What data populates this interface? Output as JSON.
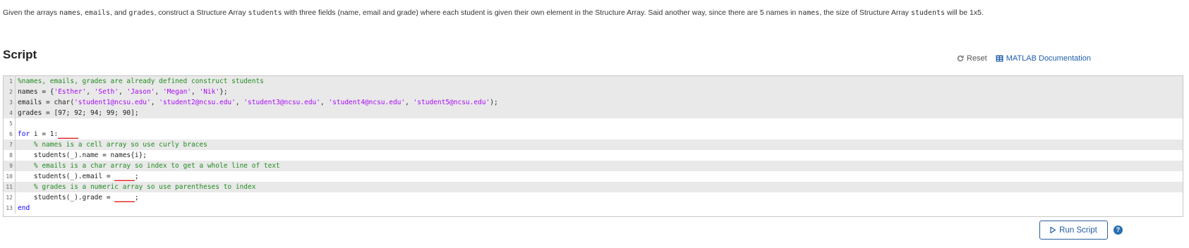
{
  "description": {
    "t1": "Given the arrays ",
    "c1": "names",
    "t2": ", ",
    "c2": "emails",
    "t3": ", and ",
    "c3": "grades",
    "t4": ", construct a Structure Array ",
    "c4": "students",
    "t5": " with three fields (name, email and grade) where each student is given their own element in the Structure Array. Said another way, since there are 5 names in ",
    "c5": "names",
    "t6": ", the size of Structure Array ",
    "c6": "students",
    "t7": " will be 1x5."
  },
  "section_title": "Script",
  "actions": {
    "reset_label": "Reset",
    "docs_label": "MATLAB Documentation"
  },
  "editor": {
    "line_numbers": [
      "1",
      "2",
      "3",
      "4",
      "5",
      "6",
      "7",
      "8",
      "9",
      "10",
      "11",
      "12",
      "13"
    ],
    "l1": "%names, emails, grades are already defined construct students",
    "l2a": "names = {",
    "l2s1": "'Esther'",
    "l2s2": "'Seth'",
    "l2s3": "'Jason'",
    "l2s4": "'Megan'",
    "l2s5": "'Nik'",
    "l2e": "};",
    "l3a": "emails = char(",
    "l3s1": "'student1@ncsu.edu'",
    "l3s2": "'student2@ncsu.edu'",
    "l3s3": "'student3@ncsu.edu'",
    "l3s4": "'student4@ncsu.edu'",
    "l3s5": "'student5@ncsu.edu'",
    "l3e": ");",
    "l4": "grades = [97; 92; 94; 99; 90];",
    "l6kw": "for",
    "l6a": " i = 1:",
    "l6blank": "_____",
    "l7": "    % names is a cell array so use curly braces",
    "l8": "    students(_).name = names{i};",
    "l9": "    % emails is a char array so index to get a whole line of text",
    "l10a": "    students(_).email = ",
    "l10blank": "_____",
    "l10e": ";",
    "l11": "    % grades is a numeric array so use parentheses to index",
    "l12a": "    students(_).grade = ",
    "l12blank": "_____",
    "l12e": ";",
    "l13": "end",
    "sep": ", "
  },
  "run_button_label": "Run Script",
  "help_label": "?"
}
